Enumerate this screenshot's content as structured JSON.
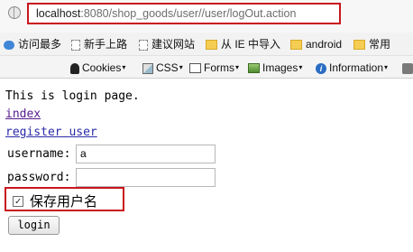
{
  "browser": {
    "url_host": "localhost",
    "url_rest": ":8080/shop_goods/user//user/logOut.action"
  },
  "bookmarks": [
    {
      "label": "访问最多",
      "icon": "globe-icon"
    },
    {
      "label": "新手上路",
      "icon": "page-icon"
    },
    {
      "label": "建议网站",
      "icon": "page-icon"
    },
    {
      "label": "从 IE 中导入",
      "icon": "folder-icon"
    },
    {
      "label": "android",
      "icon": "folder-icon"
    },
    {
      "label": "常用",
      "icon": "folder-icon"
    }
  ],
  "devtools": [
    {
      "label": "Cookies",
      "icon": "person-icon"
    },
    {
      "label": "CSS",
      "icon": "css-icon"
    },
    {
      "label": "Forms",
      "icon": "form-icon"
    },
    {
      "label": "Images",
      "icon": "image-icon"
    },
    {
      "label": "Information",
      "icon": "info-icon"
    }
  ],
  "page": {
    "intro": "This is login page.",
    "index_link": "index",
    "register_link": "register user",
    "username_label": "username:",
    "username_value": "a",
    "password_label": "password:",
    "password_value": "",
    "remember_label": "保存用户名",
    "remember_checked": "✓",
    "login_button": "login"
  },
  "colors": {
    "highlight": "#c8161d",
    "link": "#2a2aa8"
  }
}
